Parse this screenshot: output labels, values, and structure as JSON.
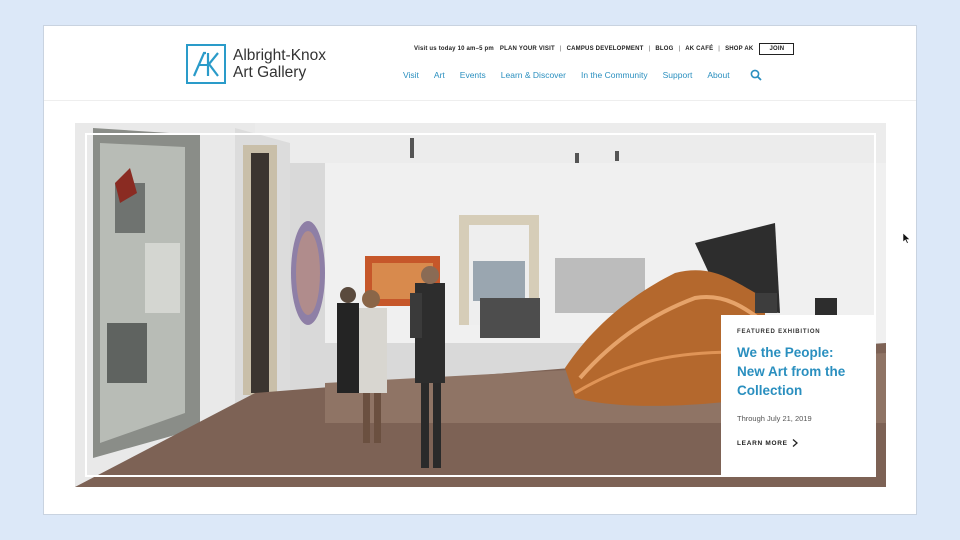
{
  "logo": {
    "line1": "Albright-Knox",
    "line2": "Art Gallery",
    "mark": "AK"
  },
  "utility": {
    "hours": "Visit us today 10 am–5 pm",
    "links": [
      "PLAN YOUR VISIT",
      "CAMPUS DEVELOPMENT",
      "BLOG",
      "AK CAFÉ",
      "SHOP AK"
    ],
    "join": "JOIN"
  },
  "nav": {
    "items": [
      "Visit",
      "Art",
      "Events",
      "Learn & Discover",
      "In the Community",
      "Support",
      "About"
    ],
    "search_icon": "search-icon"
  },
  "feature": {
    "eyebrow": "FEATURED EXHIBITION",
    "title": "We the People: New Art from the Collection",
    "dates": "Through July 21, 2019",
    "cta": "LEARN MORE"
  },
  "colors": {
    "accent": "#2a8fbf",
    "page_bg": "#dce8f8"
  }
}
